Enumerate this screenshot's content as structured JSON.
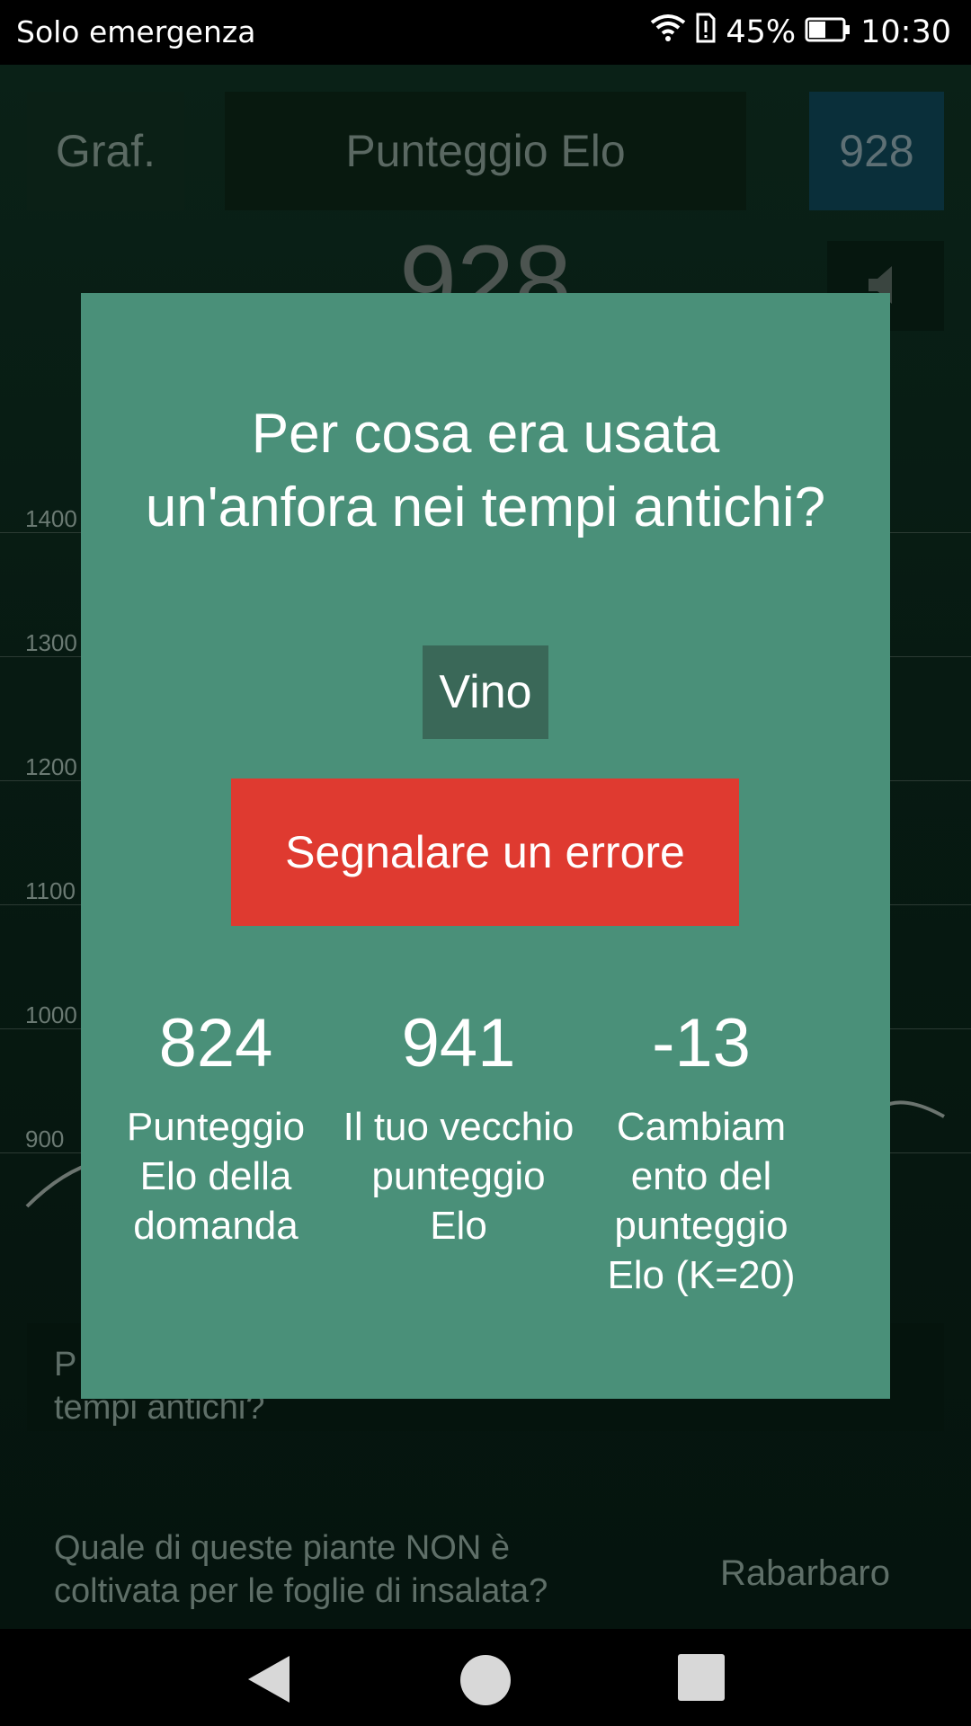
{
  "status_bar": {
    "carrier": "Solo emergenza",
    "battery": "45%",
    "time": "10:30"
  },
  "header": {
    "graph_button": "Graf.",
    "title": "Punteggio Elo",
    "score_badge": "928"
  },
  "current_score": "928",
  "chart": {
    "y_labels": [
      "1400",
      "1300",
      "1200",
      "1100",
      "1000",
      "900"
    ]
  },
  "background_questions": [
    {
      "text": "P",
      "text_line2": "tempi antichi?",
      "answer": ""
    },
    {
      "text": "Quale di queste piante NON è",
      "text_line2": "coltivata per le foglie di insalata?",
      "answer": "Rabarbaro"
    }
  ],
  "dialog": {
    "question": "Per cosa era usata un'anfora nei tempi antichi?",
    "answer": "Vino",
    "report_button": "Segnalare un errore",
    "stats": [
      {
        "value": "824",
        "label": "Punteggio Elo della domanda"
      },
      {
        "value": "941",
        "label": "Il tuo vecchio punteggio Elo"
      },
      {
        "value": "-13",
        "label": "Cambiam ento del punteggio Elo (K=20)"
      }
    ]
  },
  "colors": {
    "dialog_bg": "#4a9079",
    "report_button": "#df3a30",
    "answer_chip": "#3a6858"
  }
}
